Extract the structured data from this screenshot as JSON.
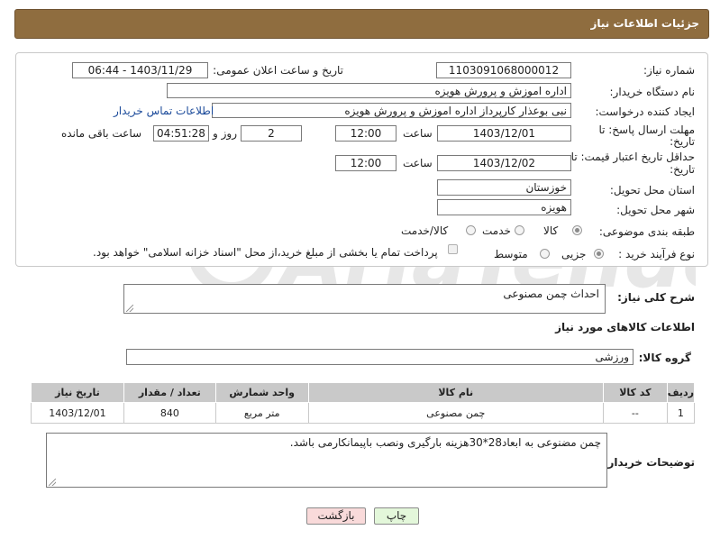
{
  "header": {
    "title": "جزئیات اطلاعات نیاز"
  },
  "need_number": {
    "label": "شماره نیاز:",
    "value": "1103091068000012"
  },
  "announce_datetime": {
    "label": "تاریخ و ساعت اعلان عمومی:",
    "value": "1403/11/29 - 06:44"
  },
  "buyer_org": {
    "label": "نام دستگاه خریدار:",
    "value": "اداره اموزش و پرورش هویزه"
  },
  "creator": {
    "label": "ایجاد کننده درخواست:",
    "value": "نبی بوعذار کارپرداز اداره اموزش و پرورش هویزه",
    "contact_link": "اطلاعات تماس خریدار"
  },
  "deadline": {
    "label_line1": "مهلت ارسال پاسخ: تا",
    "label_line2": "تاریخ:",
    "date": "1403/12/01",
    "time_label": "ساعت",
    "time": "12:00",
    "days": "2",
    "days_label": "روز و",
    "remaining": "04:51:28",
    "remaining_label": "ساعت باقی مانده"
  },
  "price_validity": {
    "label_line1": "حداقل تاریخ اعتبار قیمت: تا",
    "label_line2": "تاریخ:",
    "date": "1403/12/02",
    "time_label": "ساعت",
    "time": "12:00"
  },
  "delivery_province": {
    "label": "استان محل تحویل:",
    "value": "خوزستان"
  },
  "delivery_city": {
    "label": "شهر محل تحویل:",
    "value": "هویزه"
  },
  "category": {
    "label": "طبقه بندی موضوعی:",
    "options": [
      "کالا",
      "خدمت",
      "کالا/خدمت"
    ],
    "selected": "کالا"
  },
  "purchase_type": {
    "label": "نوع فرآیند خرید :",
    "options": [
      "جزیی",
      "متوسط"
    ],
    "selected": "جزیی",
    "payment_note": "پرداخت تمام یا بخشی از مبلغ خرید،از محل \"اسناد خزانه اسلامی\" خواهد بود."
  },
  "description": {
    "label": "شرح کلی نیاز:",
    "value": "احداث چمن مصنوعی"
  },
  "goods_section": {
    "title": "اطلاعات کالاهای مورد نیاز"
  },
  "goods_group": {
    "label": "گروه کالا:",
    "value": "ورزشی"
  },
  "items_table": {
    "headers": [
      "ردیف",
      "کد کالا",
      "نام کالا",
      "واحد شمارش",
      "تعداد / مقدار",
      "تاریخ نیاز"
    ],
    "rows": [
      [
        "1",
        "--",
        "چمن مصنوعی",
        "متر مربع",
        "840",
        "1403/12/01"
      ]
    ]
  },
  "buyer_notes": {
    "label": "توضیحات خریدار:",
    "value": "چمن مضنوعی به ابعاد28*30هزینه بارگیری ونصب باپیمانکارمی باشد."
  },
  "buttons": {
    "print": "چاپ",
    "back": "بازگشت"
  },
  "colors": {
    "header_bg": "#8f6d3f",
    "table_header_bg": "#c9c9c9",
    "back_button_bg": "#f9dada",
    "print_button_bg": "#e3f7da"
  }
}
